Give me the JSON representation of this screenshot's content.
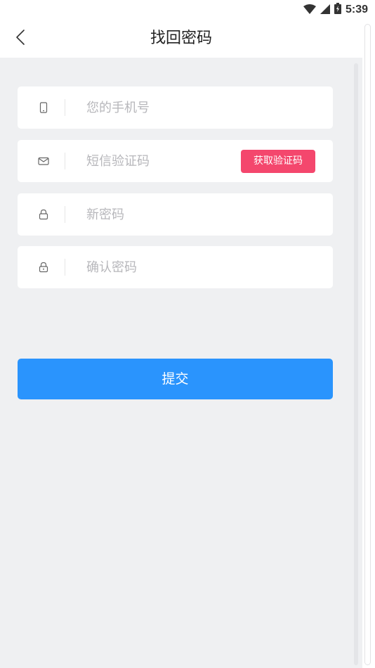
{
  "status_bar": {
    "time": "5:39",
    "icons": [
      "wifi-icon",
      "signal-icon",
      "battery-icon"
    ]
  },
  "header": {
    "title": "找回密码",
    "back_icon": "chevron-left-icon"
  },
  "form": {
    "phone": {
      "placeholder": "您的手机号",
      "value": "",
      "icon": "phone-icon"
    },
    "sms_code": {
      "placeholder": "短信验证码",
      "value": "",
      "icon": "mail-icon",
      "button_label": "获取验证码"
    },
    "new_password": {
      "placeholder": "新密码",
      "value": "",
      "icon": "lock-icon"
    },
    "confirm_password": {
      "placeholder": "确认密码",
      "value": "",
      "icon": "lock-icon"
    },
    "submit_label": "提交"
  },
  "colors": {
    "accent": "#2a94fd",
    "code_button": "#f4476d",
    "background": "#eff0f2",
    "placeholder": "#b7b7bb"
  }
}
